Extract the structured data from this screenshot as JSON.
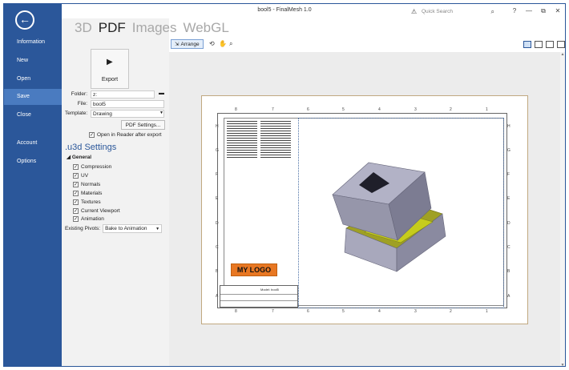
{
  "window": {
    "title": "bool5 - FinalMesh 1.0",
    "quick_search_placeholder": "Quick Search",
    "controls": [
      "?",
      "—",
      "⧉",
      "✕"
    ]
  },
  "backstage": {
    "back_icon": "back-arrow-icon",
    "items": [
      {
        "label": "Information"
      },
      {
        "label": "New"
      },
      {
        "label": "Open"
      },
      {
        "label": "Save",
        "active": true
      },
      {
        "label": "Close"
      },
      {
        "label": "Account"
      },
      {
        "label": "Options"
      }
    ]
  },
  "main_tabs": [
    {
      "label": "3D"
    },
    {
      "label": "PDF",
      "active": true
    },
    {
      "label": "Images"
    },
    {
      "label": "WebGL"
    }
  ],
  "export": {
    "label": "Export"
  },
  "form": {
    "folder_label": "Folder:",
    "folder_value": "z:",
    "file_label": "File:",
    "file_value": "bool5",
    "template_label": "Template:",
    "template_value": "Drawing",
    "pdf_settings_label": "PDF Settings...",
    "open_in_reader_label": "Open in Reader after export",
    "open_in_reader_checked": true
  },
  "u3d": {
    "title": ".u3d Settings",
    "group": "General",
    "options": [
      {
        "label": "Compression",
        "checked": true
      },
      {
        "label": "UV",
        "checked": true
      },
      {
        "label": "Normals",
        "checked": true
      },
      {
        "label": "Materials",
        "checked": true
      },
      {
        "label": "Textures",
        "checked": true
      },
      {
        "label": "Current Viewport",
        "checked": true
      },
      {
        "label": "Animation",
        "checked": true
      }
    ],
    "pivots_label": "Existing Pivots:",
    "pivots_value": "Bake to Animation"
  },
  "toolbar": {
    "arrange_label": "Arrange",
    "tools": [
      "orbit-icon",
      "pan-hand-icon",
      "zoom-icon"
    ],
    "views": [
      "single-page-view-icon",
      "two-page-view-icon",
      "grid-view-icon",
      "continuous-view-icon"
    ]
  },
  "drawing": {
    "columns_top": [
      "8",
      "7",
      "6",
      "5",
      "4",
      "3",
      "2",
      "1"
    ],
    "rows_side": [
      "H",
      "G",
      "F",
      "E",
      "D",
      "C",
      "B",
      "A"
    ],
    "logo_text": "MY LOGO",
    "title_block_text": "Model: bool5",
    "colors": {
      "logo": "#e87722",
      "model_body": "#9e9eb4",
      "model_ring": "#c8d020"
    }
  }
}
